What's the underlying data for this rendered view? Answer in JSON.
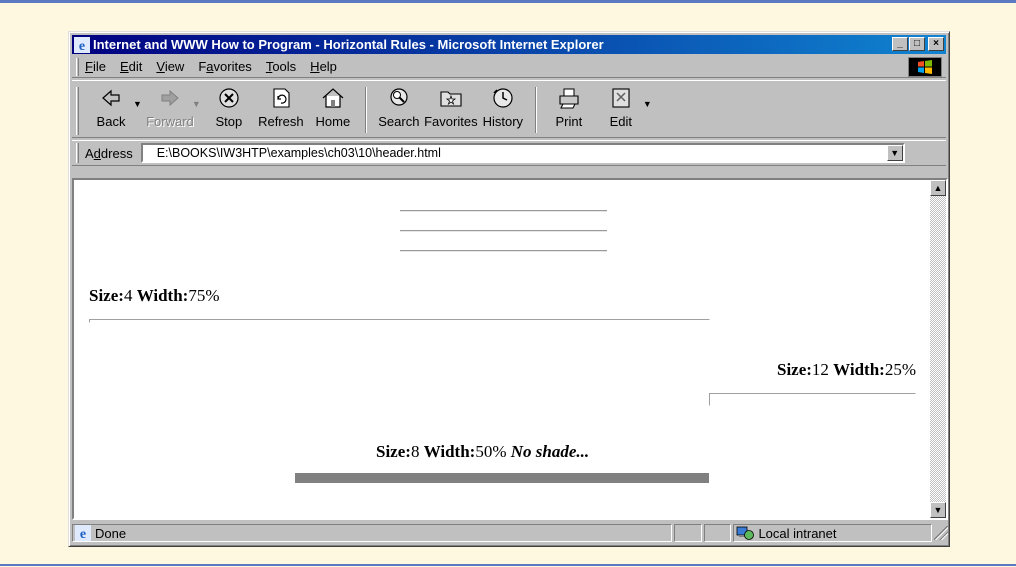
{
  "window": {
    "title": "Internet and WWW How to Program - Horizontal Rules - Microsoft Internet Explorer"
  },
  "menu": {
    "items": [
      {
        "pre": "",
        "key": "F",
        "post": "ile"
      },
      {
        "pre": "",
        "key": "E",
        "post": "dit"
      },
      {
        "pre": "",
        "key": "V",
        "post": "iew"
      },
      {
        "pre": "F",
        "key": "a",
        "post": "vorites"
      },
      {
        "pre": "",
        "key": "T",
        "post": "ools"
      },
      {
        "pre": "",
        "key": "H",
        "post": "elp"
      }
    ]
  },
  "toolbar": {
    "back": "Back",
    "forward": "Forward",
    "stop": "Stop",
    "refresh": "Refresh",
    "home": "Home",
    "search": "Search",
    "favorites": "Favorites",
    "history": "History",
    "print": "Print",
    "edit": "Edit"
  },
  "address": {
    "label_pre": "A",
    "label_key": "d",
    "label_post": "dress",
    "url": "E:\\BOOKS\\IW3HTP\\examples\\ch03\\10\\header.html"
  },
  "content": {
    "rule1": {
      "size_label": "Size:",
      "size_value": "4",
      "width_label": "Width:",
      "width_value": "75%"
    },
    "rule2": {
      "size_label": "Size:",
      "size_value": "12",
      "width_label": "Width:",
      "width_value": "25%"
    },
    "rule3": {
      "size_label": "Size:",
      "size_value": "8",
      "width_label": "Width:",
      "width_value": "50%",
      "note": "No shade..."
    }
  },
  "status": {
    "text": "Done",
    "zone": "Local intranet"
  },
  "colors": {
    "title_gradient_start": "#000080",
    "title_gradient_end": "#1084d0",
    "chrome": "#c0c0c0",
    "page_background": "#fff8e1",
    "accent_rule": "#5a79c0"
  }
}
